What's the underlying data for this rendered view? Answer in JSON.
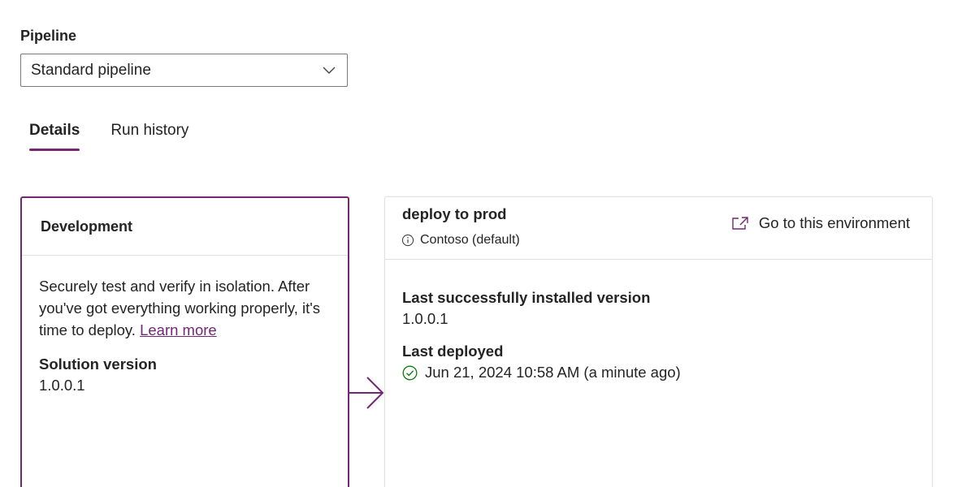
{
  "pipeline": {
    "label": "Pipeline",
    "selected": "Standard pipeline"
  },
  "tabs": [
    {
      "label": "Details",
      "active": true
    },
    {
      "label": "Run history",
      "active": false
    }
  ],
  "development": {
    "title": "Development",
    "description": "Securely test and verify in isolation. After you've got everything working properly, it's time to deploy.",
    "learn_more": "Learn more",
    "solution_version_label": "Solution version",
    "solution_version": "1.0.0.1"
  },
  "stage": {
    "title": "deploy to prod",
    "environment": "Contoso (default)",
    "goto_label": "Go to this environment",
    "last_installed_label": "Last successfully installed version",
    "last_installed_version": "1.0.0.1",
    "last_deployed_label": "Last deployed",
    "last_deployed_value": "Jun 21, 2024 10:58 AM (a minute ago)"
  },
  "icons": {
    "dropdown": "chevron-down-icon",
    "info": "info-icon",
    "external": "open-external-icon",
    "success": "checkmark-circle-icon",
    "flow": "arrow-right-icon"
  },
  "colors": {
    "accent": "#742774",
    "success": "#107c10"
  }
}
